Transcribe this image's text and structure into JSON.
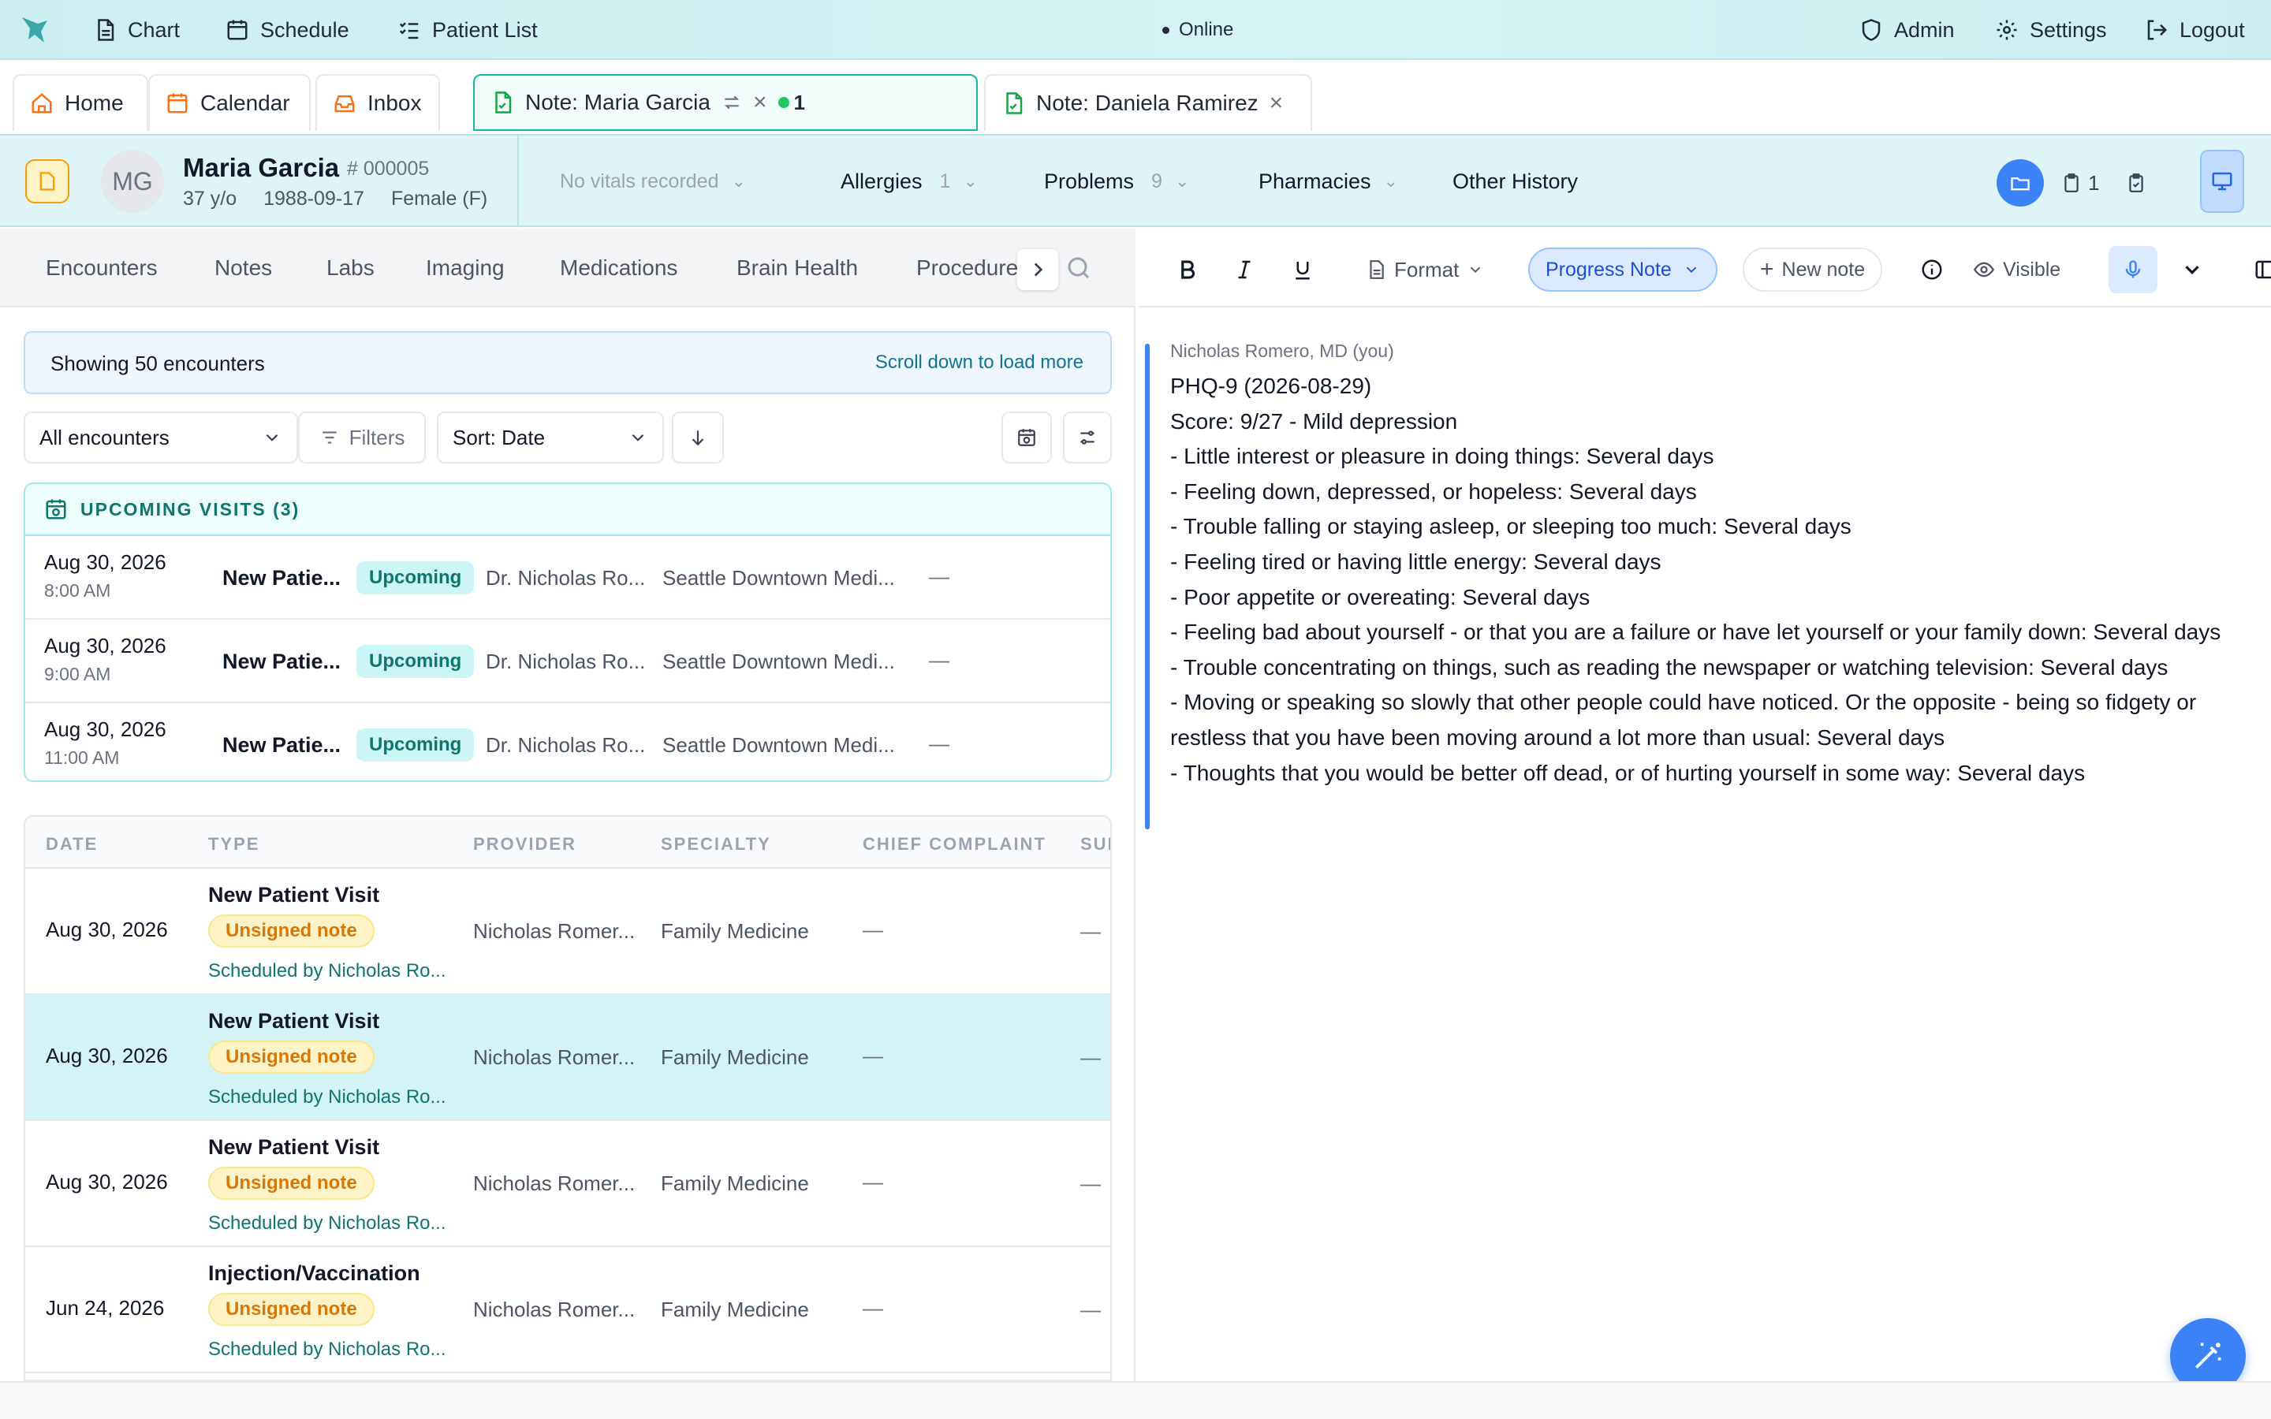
{
  "topnav": {
    "chart": "Chart",
    "schedule": "Schedule",
    "patient_list": "Patient List",
    "status": "Online",
    "admin": "Admin",
    "settings": "Settings",
    "logout": "Logout"
  },
  "tabs": {
    "home": "Home",
    "calendar": "Calendar",
    "inbox": "Inbox",
    "note1": "Note: Maria Garcia",
    "note1_badge": "1",
    "note2": "Note: Daniela Ramirez"
  },
  "patient": {
    "initials": "MG",
    "name": "Maria Garcia",
    "id": "# 000005",
    "age": "37 y/o",
    "dob": "1988-09-17",
    "sex": "Female (F)",
    "vitals": "No vitals recorded",
    "allergies_label": "Allergies",
    "allergies_count": "1",
    "problems_label": "Problems",
    "problems_count": "9",
    "pharmacies_label": "Pharmacies",
    "other_history_label": "Other History",
    "clipboard_count": "1"
  },
  "left_tabs": [
    "Encounters",
    "Notes",
    "Labs",
    "Imaging",
    "Medications",
    "Brain Health",
    "Procedure"
  ],
  "encounters": {
    "showing": "Showing 50 encounters",
    "load_more": "Scroll down to load more",
    "filter_select": "All encounters",
    "filters_label": "Filters",
    "sort_label": "Sort: Date",
    "upcoming_header": "UPCOMING VISITS (3)",
    "upcoming": [
      {
        "date": "Aug 30, 2026",
        "time": "8:00 AM",
        "type": "New Patie...",
        "status": "Upcoming",
        "provider": "Dr. Nicholas Ro...",
        "location": "Seattle Downtown Medi...",
        "extra": "—"
      },
      {
        "date": "Aug 30, 2026",
        "time": "9:00 AM",
        "type": "New Patie...",
        "status": "Upcoming",
        "provider": "Dr. Nicholas Ro...",
        "location": "Seattle Downtown Medi...",
        "extra": "—"
      },
      {
        "date": "Aug 30, 2026",
        "time": "11:00 AM",
        "type": "New Patie...",
        "status": "Upcoming",
        "provider": "Dr. Nicholas Ro...",
        "location": "Seattle Downtown Medi...",
        "extra": "—"
      }
    ],
    "columns": [
      "DATE",
      "TYPE",
      "PROVIDER",
      "SPECIALTY",
      "CHIEF COMPLAINT",
      "SUI"
    ],
    "rows": [
      {
        "date": "Aug 30, 2026",
        "type": "New Patient Visit",
        "badge": "Unsigned note",
        "sched": "Scheduled by Nicholas Ro...",
        "provider": "Nicholas Romer...",
        "specialty": "Family Medicine",
        "cc": "—",
        "summary": "—"
      },
      {
        "date": "Aug 30, 2026",
        "type": "New Patient Visit",
        "badge": "Unsigned note",
        "sched": "Scheduled by Nicholas Ro...",
        "provider": "Nicholas Romer...",
        "specialty": "Family Medicine",
        "cc": "—",
        "summary": "—"
      },
      {
        "date": "Aug 30, 2026",
        "type": "New Patient Visit",
        "badge": "Unsigned note",
        "sched": "Scheduled by Nicholas Ro...",
        "provider": "Nicholas Romer...",
        "specialty": "Family Medicine",
        "cc": "—",
        "summary": "—"
      },
      {
        "date": "Jun 24, 2026",
        "type": "Injection/Vaccination",
        "badge": "Unsigned note",
        "sched": "Scheduled by Nicholas Ro...",
        "provider": "Nicholas Romer...",
        "specialty": "Family Medicine",
        "cc": "—",
        "summary": "—"
      }
    ]
  },
  "editor": {
    "format_label": "Format",
    "note_type": "Progress Note",
    "new_note": "New note",
    "visible_label": "Visible",
    "author": "Nicholas Romero, MD (you)",
    "lines": [
      "PHQ-9 (2026-08-29)",
      "Score: 9/27 - Mild depression",
      "- Little interest or pleasure in doing things: Several days",
      "- Feeling down, depressed, or hopeless: Several days",
      "- Trouble falling or staying asleep, or sleeping too much: Several days",
      "- Feeling tired or having little energy: Several days",
      "- Poor appetite or overeating: Several days",
      "- Feeling bad about yourself - or that you are a failure or have let yourself or your family down: Several days",
      "- Trouble concentrating on things, such as reading the newspaper or watching television: Several days",
      "- Moving or speaking so slowly that other people could have noticed. Or the opposite - being so fidgety or restless that you have been moving around a lot more than usual: Several days",
      "- Thoughts that you would be better off dead, or of hurting yourself in some way: Several days"
    ]
  },
  "colors": {
    "accent_teal": "#0f766e",
    "accent_blue": "#3b82f6",
    "unsigned_amber": "#d97706"
  }
}
